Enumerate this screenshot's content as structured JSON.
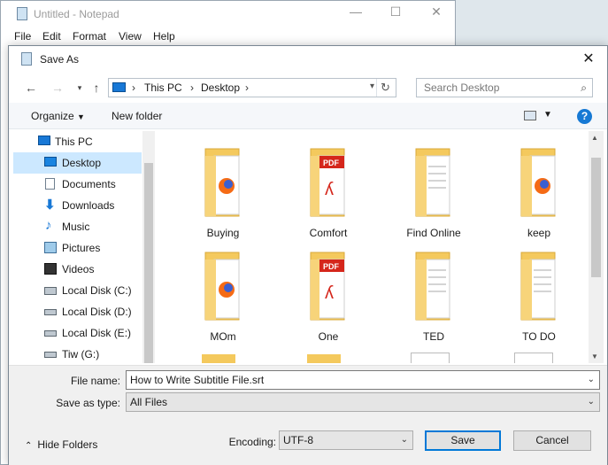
{
  "notepad": {
    "title": "Untitled - Notepad",
    "menu": [
      "File",
      "Edit",
      "Format",
      "View",
      "Help"
    ]
  },
  "dialog": {
    "title": "Save As",
    "address": {
      "crumbs": [
        "This PC",
        "Desktop"
      ]
    },
    "search_placeholder": "Search Desktop",
    "toolbar": {
      "organize": "Organize",
      "new_folder": "New folder"
    },
    "nav_items": [
      {
        "label": "This PC",
        "icon": "computer-icon"
      },
      {
        "label": "Desktop",
        "icon": "desktop-icon",
        "selected": true
      },
      {
        "label": "Documents",
        "icon": "documents-icon"
      },
      {
        "label": "Downloads",
        "icon": "downloads-icon"
      },
      {
        "label": "Music",
        "icon": "music-icon"
      },
      {
        "label": "Pictures",
        "icon": "pictures-icon"
      },
      {
        "label": "Videos",
        "icon": "videos-icon"
      },
      {
        "label": "Local Disk (C:)",
        "icon": "drive-icon"
      },
      {
        "label": "Local Disk (D:)",
        "icon": "drive-icon"
      },
      {
        "label": "Local Disk (E:)",
        "icon": "drive-icon"
      },
      {
        "label": "Tiw (G:)",
        "icon": "drive-icon"
      }
    ],
    "files": [
      {
        "name": "Buying",
        "icon": "folder-firefox-icon"
      },
      {
        "name": "Comfort",
        "icon": "folder-pdf-icon"
      },
      {
        "name": "Find Online",
        "icon": "folder-docs-icon"
      },
      {
        "name": "keep",
        "icon": "folder-firefox-icon"
      },
      {
        "name": "MOm",
        "icon": "folder-firefox-icon"
      },
      {
        "name": "One",
        "icon": "folder-pdf-icon"
      },
      {
        "name": "TED",
        "icon": "folder-docs-icon"
      },
      {
        "name": "TO DO",
        "icon": "folder-docs-icon"
      }
    ],
    "form": {
      "file_name_label": "File name:",
      "file_name_value": "How to Write Subtitle File.srt",
      "save_as_type_label": "Save as type:",
      "save_as_type_value": "All Files",
      "encoding_label": "Encoding:",
      "encoding_value": "UTF-8",
      "save": "Save",
      "cancel": "Cancel",
      "hide_folders": "Hide Folders"
    },
    "colors": {
      "accent": "#0078d7",
      "selected_bg": "#cce8ff",
      "folder": "#f4c95d",
      "pdf_red": "#d5261b",
      "firefox_orange": "#f56b15"
    }
  }
}
